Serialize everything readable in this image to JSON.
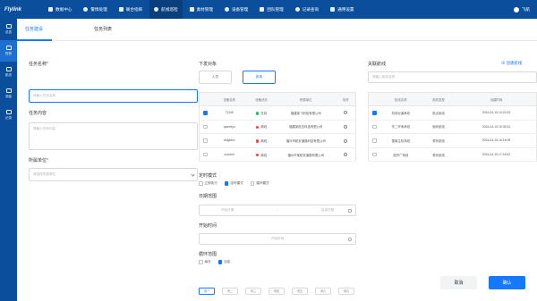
{
  "app": {
    "logo": "Flylink",
    "user_name": "飞航"
  },
  "topnav": [
    {
      "label": "数据中心",
      "icon": "home-icon"
    },
    {
      "label": "警情处理",
      "icon": "alert-icon"
    },
    {
      "label": "联合指挥",
      "icon": "command-icon"
    },
    {
      "label": "航线巡检",
      "icon": "route-icon"
    },
    {
      "label": "素材管理",
      "icon": "folder-icon"
    },
    {
      "label": "设备管理",
      "icon": "device-icon"
    },
    {
      "label": "团队管理",
      "icon": "team-icon"
    },
    {
      "label": "记录查询",
      "icon": "record-icon"
    },
    {
      "label": "通用设置",
      "icon": "gear-icon"
    }
  ],
  "sidebar": [
    {
      "label": "总表"
    },
    {
      "label": "任务"
    },
    {
      "label": "航线"
    },
    {
      "label": "测量"
    },
    {
      "label": "记录"
    }
  ],
  "tabs": {
    "create": "任务建设",
    "list": "任务列表"
  },
  "form": {
    "name_label": "任务名称",
    "name_placeholder": "请输入任务名称",
    "content_label": "任务内容",
    "content_placeholder": "请输入任务内容",
    "unit_label": "所属单位",
    "unit_placeholder": "请选择所属单位"
  },
  "target": {
    "label": "下发对象",
    "options": [
      "人员",
      "机场"
    ]
  },
  "device_table": {
    "headers": [
      "",
      "设备名称",
      "设备状态",
      "所属单位",
      "操作"
    ],
    "rows": [
      {
        "checked": true,
        "name": "T(345",
        "status": "在线",
        "status_color": "#22c55e",
        "unit": "福建某飞科技有限公司"
      },
      {
        "checked": false,
        "name": "qwerttyu",
        "status": "离线",
        "status_color": "#ef4444",
        "unit": "福建某航空科技有限公司"
      },
      {
        "checked": false,
        "name": "sfdgfdcx",
        "status": "离线",
        "status_color": "#ef4444",
        "unit": "福州市航安道路科技有限公司"
      },
      {
        "checked": false,
        "name": "zxscmh",
        "status": "离线",
        "status_color": "#ef4444",
        "unit": "福州市某航安道路有限公司"
      }
    ]
  },
  "route": {
    "label": "关联航线",
    "create_link": "创建航线",
    "search_placeholder": "请输入航线名称",
    "headers": [
      "",
      "航线名称",
      "航线类型",
      "创建时间"
    ],
    "rows": [
      {
        "checked": true,
        "name": "机场北道承线",
        "type": "航点航线",
        "time": "2024-04-15 14:23:29"
      },
      {
        "checked": false,
        "name": "东二环承承线",
        "type": "面状航线",
        "time": "2024-04-15 15:35:31"
      },
      {
        "checked": false,
        "name": "雪莱主机场线",
        "type": "带状航线",
        "time": "2024-04-15 16:15:05"
      },
      {
        "checked": false,
        "name": "医护广场线",
        "type": "带状航线",
        "time": "2024-04-15 17:18:42"
      }
    ]
  },
  "schedule": {
    "mode_label": "定时模式",
    "modes": [
      {
        "label": "立即执行",
        "checked": false
      },
      {
        "label": "定时模式",
        "checked": true
      },
      {
        "label": "循环模式",
        "checked": false
      }
    ],
    "date_range_label": "日期范围",
    "start_date_placeholder": "开始日期",
    "range_sep": "~",
    "end_date_placeholder": "结束日期",
    "start_time_label": "开始时间",
    "start_time_placeholder": "开始时间",
    "cycle_label": "循环范围",
    "cycle_options": [
      {
        "label": "每天",
        "checked": false
      },
      {
        "label": "自定",
        "checked": true
      }
    ],
    "days": [
      {
        "label": "周一",
        "selected": true
      },
      {
        "label": "周二",
        "selected": false
      },
      {
        "label": "周三",
        "selected": false
      },
      {
        "label": "周四",
        "selected": false
      },
      {
        "label": "周五",
        "selected": false
      },
      {
        "label": "周六",
        "selected": false
      },
      {
        "label": "周日",
        "selected": false
      }
    ]
  },
  "actions": {
    "cancel": "取消",
    "confirm": "确认"
  }
}
